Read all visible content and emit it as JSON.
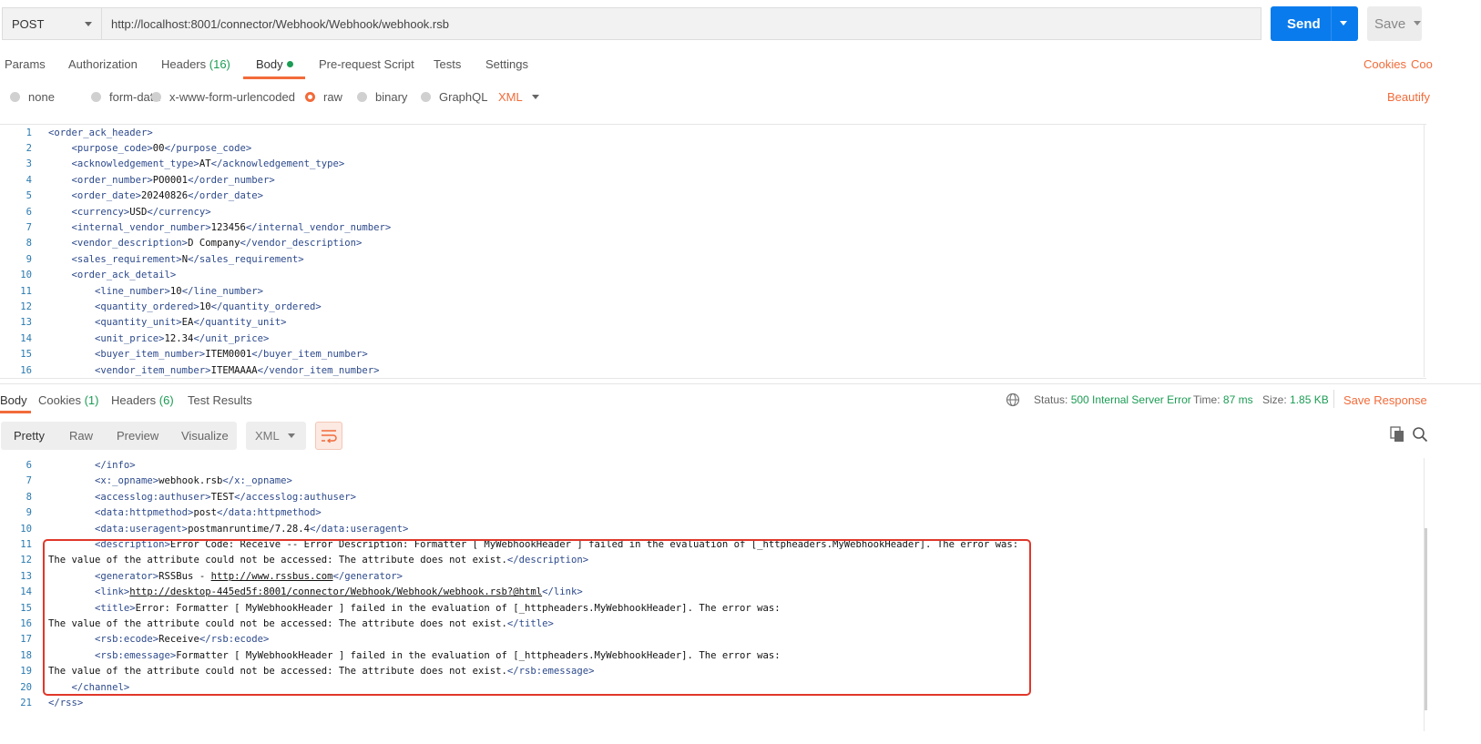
{
  "request": {
    "method": "POST",
    "url": "http://localhost:8001/connector/Webhook/Webhook/webhook.rsb",
    "send_label": "Send",
    "save_label": "Save"
  },
  "request_tabs": {
    "params": "Params",
    "authorization": "Authorization",
    "headers": "Headers",
    "headers_count": "(16)",
    "body": "Body",
    "prerequest": "Pre-request Script",
    "tests": "Tests",
    "settings": "Settings",
    "cookies": "Cookies",
    "code": "Coo"
  },
  "body_types": {
    "none": "none",
    "form_data": "form-data",
    "urlencoded": "x-www-form-urlencoded",
    "raw": "raw",
    "binary": "binary",
    "graphql": "GraphQL",
    "selected": "raw",
    "format": "XML",
    "beautify": "Beautify"
  },
  "request_body_lines": [
    {
      "n": "1",
      "indent": 0,
      "open": "<order_ack_header>",
      "value": "",
      "close": ""
    },
    {
      "n": "2",
      "indent": 1,
      "open": "<purpose_code>",
      "value": "00",
      "close": "</purpose_code>"
    },
    {
      "n": "3",
      "indent": 1,
      "open": "<acknowledgement_type>",
      "value": "AT",
      "close": "</acknowledgement_type>"
    },
    {
      "n": "4",
      "indent": 1,
      "open": "<order_number>",
      "value": "PO0001",
      "close": "</order_number>"
    },
    {
      "n": "5",
      "indent": 1,
      "open": "<order_date>",
      "value": "20240826",
      "close": "</order_date>"
    },
    {
      "n": "6",
      "indent": 1,
      "open": "<currency>",
      "value": "USD",
      "close": "</currency>"
    },
    {
      "n": "7",
      "indent": 1,
      "open": "<internal_vendor_number>",
      "value": "123456",
      "close": "</internal_vendor_number>"
    },
    {
      "n": "8",
      "indent": 1,
      "open": "<vendor_description>",
      "value": "D Company",
      "close": "</vendor_description>"
    },
    {
      "n": "9",
      "indent": 1,
      "open": "<sales_requirement>",
      "value": "N",
      "close": "</sales_requirement>"
    },
    {
      "n": "10",
      "indent": 1,
      "open": "<order_ack_detail>",
      "value": "",
      "close": ""
    },
    {
      "n": "11",
      "indent": 2,
      "open": "<line_number>",
      "value": "10",
      "close": "</line_number>"
    },
    {
      "n": "12",
      "indent": 2,
      "open": "<quantity_ordered>",
      "value": "10",
      "close": "</quantity_ordered>"
    },
    {
      "n": "13",
      "indent": 2,
      "open": "<quantity_unit>",
      "value": "EA",
      "close": "</quantity_unit>"
    },
    {
      "n": "14",
      "indent": 2,
      "open": "<unit_price>",
      "value": "12.34",
      "close": "</unit_price>"
    },
    {
      "n": "15",
      "indent": 2,
      "open": "<buyer_item_number>",
      "value": "ITEM0001",
      "close": "</buyer_item_number>"
    },
    {
      "n": "16",
      "indent": 2,
      "open": "<vendor_item_number>",
      "value": "ITEMAAAA",
      "close": "</vendor_item_number>"
    }
  ],
  "response_tabs": {
    "body": "Body",
    "cookies": "Cookies",
    "cookies_count": "(1)",
    "headers": "Headers",
    "headers_count": "(6)",
    "test_results": "Test Results"
  },
  "response_status": {
    "status_label": "Status:",
    "status_value": "500 Internal Server Error",
    "time_label": "Time:",
    "time_value": "87 ms",
    "size_label": "Size:",
    "size_value": "1.85 KB",
    "save_response": "Save Response"
  },
  "response_view": {
    "pretty": "Pretty",
    "raw": "Raw",
    "preview": "Preview",
    "visualize": "Visualize",
    "format": "XML"
  },
  "response_body_lines": [
    {
      "n": "6",
      "indent": 2,
      "open": "",
      "value": "",
      "close": "</info>",
      "link": false
    },
    {
      "n": "7",
      "indent": 2,
      "open": "<x:_opname>",
      "value": "webhook.rsb",
      "close": "</x:_opname>",
      "link": false
    },
    {
      "n": "8",
      "indent": 2,
      "open": "<accesslog:authuser>",
      "value": "TEST",
      "close": "</accesslog:authuser>",
      "link": false
    },
    {
      "n": "9",
      "indent": 2,
      "open": "<data:httpmethod>",
      "value": "post",
      "close": "</data:httpmethod>",
      "link": false
    },
    {
      "n": "10",
      "indent": 2,
      "open": "<data:useragent>",
      "value": "postmanruntime/7.28.4",
      "close": "</data:useragent>",
      "link": false
    },
    {
      "n": "11",
      "indent": 2,
      "open": "<description>",
      "value": "Error Code: Receive -- Error Description: Formatter [ MyWebhookHeader ] failed in the evaluation of [_httpheaders.MyWebhookHeader]. The error was:",
      "close": "",
      "link": false
    },
    {
      "n": "12",
      "indent": 0,
      "open": "",
      "value": "The value of the attribute could not be accessed: The attribute does not exist.",
      "close": "</description>",
      "link": false
    },
    {
      "n": "13",
      "indent": 2,
      "open": "<generator>",
      "value": "RSSBus - http://www.rssbus.com",
      "close": "</generator>",
      "link": false
    },
    {
      "n": "14",
      "indent": 2,
      "open": "<link>",
      "value": "http://desktop-445ed5f:8001/connector/Webhook/Webhook/webhook.rsb?@html",
      "close": "</link>",
      "link": true
    },
    {
      "n": "15",
      "indent": 2,
      "open": "<title>",
      "value": "Error: Formatter [ MyWebhookHeader ] failed in the evaluation of [_httpheaders.MyWebhookHeader]. The error was:",
      "close": "",
      "link": false
    },
    {
      "n": "16",
      "indent": 0,
      "open": "",
      "value": "The value of the attribute could not be accessed: The attribute does not exist.",
      "close": "</title>",
      "link": false
    },
    {
      "n": "17",
      "indent": 2,
      "open": "<rsb:ecode>",
      "value": "Receive",
      "close": "</rsb:ecode>",
      "link": false
    },
    {
      "n": "18",
      "indent": 2,
      "open": "<rsb:emessage>",
      "value": "Formatter [ MyWebhookHeader ] failed in the evaluation of [_httpheaders.MyWebhookHeader]. The error was:",
      "close": "",
      "link": false
    },
    {
      "n": "19",
      "indent": 0,
      "open": "",
      "value": "The value of the attribute could not be accessed: The attribute does not exist.",
      "close": "</rsb:emessage>",
      "link": false
    },
    {
      "n": "20",
      "indent": 1,
      "open": "",
      "value": "",
      "close": "</channel>",
      "link": false
    },
    {
      "n": "21",
      "indent": 0,
      "open": "",
      "value": "",
      "close": "</rss>",
      "link": false
    }
  ],
  "colors": {
    "accent": "#f26b3a",
    "send_blue": "#097bed",
    "status_green": "#1c9c54",
    "highlight_red": "#e0372a"
  }
}
